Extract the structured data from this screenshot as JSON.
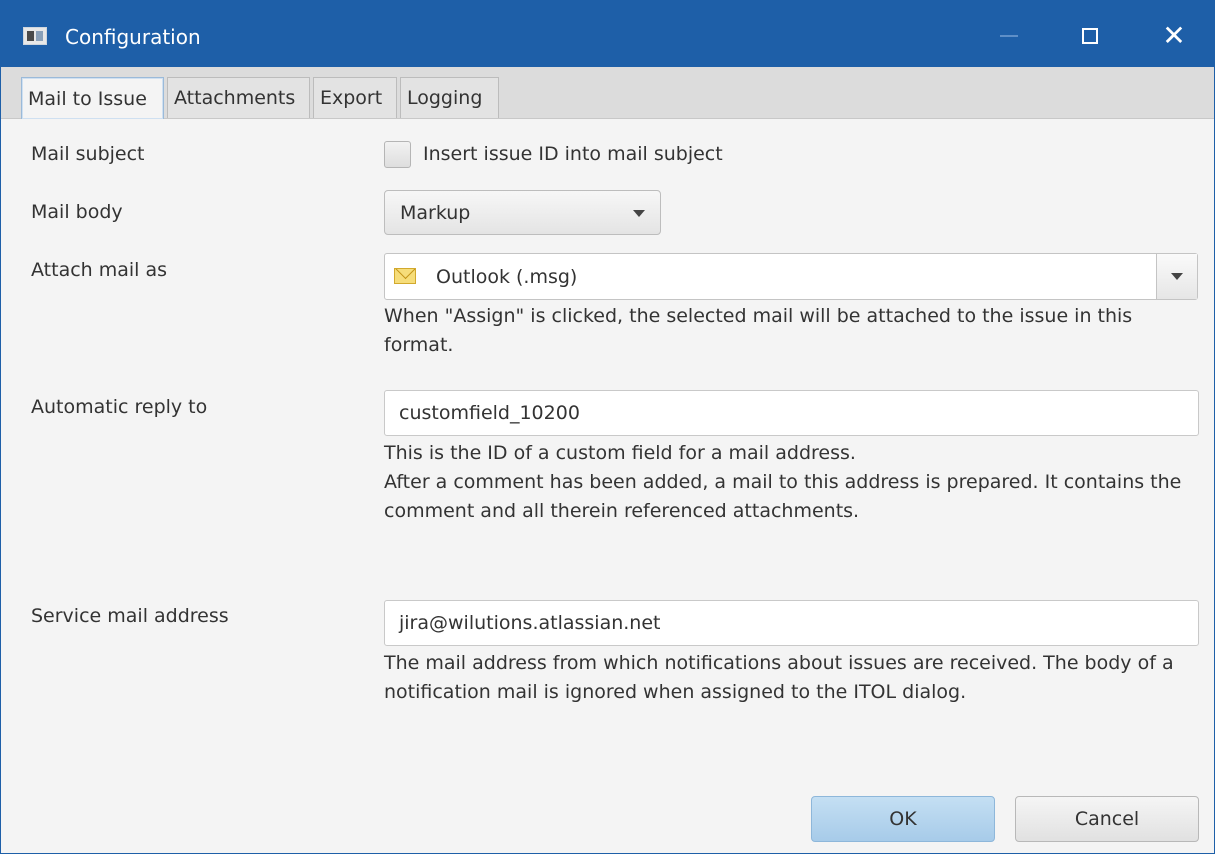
{
  "window": {
    "title": "Configuration",
    "controls": {
      "close": "✕"
    }
  },
  "tabs": [
    {
      "label": "Mail to Issue"
    },
    {
      "label": "Attachments"
    },
    {
      "label": "Export"
    },
    {
      "label": "Logging"
    }
  ],
  "form": {
    "mail_subject": {
      "label": "Mail subject",
      "checkbox_label": "Insert issue ID into mail subject",
      "checked": false
    },
    "mail_body": {
      "label": "Mail body",
      "value": "Markup"
    },
    "attach_mail_as": {
      "label": "Attach mail as",
      "value": "Outlook (.msg)",
      "icon": "mail-envelope-icon",
      "hint": "When \"Assign\" is clicked, the selected mail will be attached to the issue in this format."
    },
    "automatic_reply_to": {
      "label": "Automatic reply to",
      "value": "customfield_10200",
      "hint_line1": "This is the ID of a custom field for a mail address.",
      "hint_line2": "After a comment has been added, a mail to this address is prepared. It contains the comment and all therein referenced attachments."
    },
    "service_mail_address": {
      "label": "Service mail address",
      "value": "jira@wilutions.atlassian.net",
      "hint": "The mail address from which notifications about issues are received. The body of a notification mail is ignored when assigned to the ITOL dialog."
    }
  },
  "buttons": {
    "ok": "OK",
    "cancel": "Cancel"
  },
  "colors": {
    "titlebar": "#1e5fa8",
    "ok_button": "#b6d5ee"
  }
}
